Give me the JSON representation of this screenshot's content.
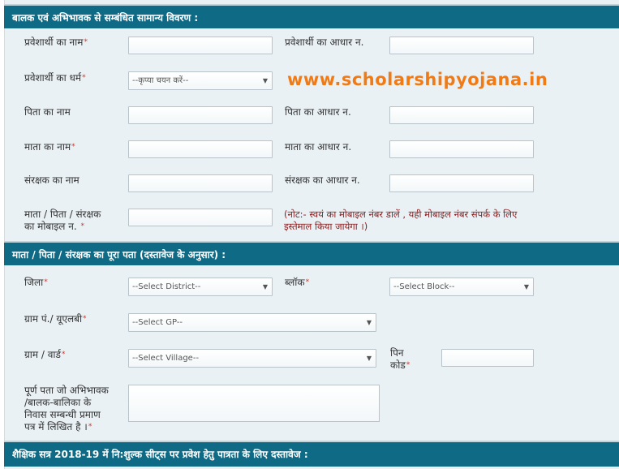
{
  "sections": {
    "general": {
      "title": "बालक एवं अभिभावक से सम्बंधित सामान्य विवरण :"
    },
    "address": {
      "title": "माता / पिता / संरक्षक का पूरा पता (दस्तावेज के अनुसार) :"
    },
    "documents": {
      "title": "शैक्षिक सत्र 2018-19 में नि:शुल्क सीट्स पर प्रवेश हेतु पात्रता के लिए दस्तावेज :"
    }
  },
  "required_marker": "*",
  "fields": {
    "student_name": {
      "label": "प्रवेशार्थी का नाम",
      "value": ""
    },
    "student_aadhar": {
      "label": "प्रवेशार्थी का आधार न.",
      "value": ""
    },
    "student_religion": {
      "label": "प्रवेशार्थी का धर्म",
      "selected": "--कृप्या चयन करें--"
    },
    "father_name": {
      "label": "पिता का नाम",
      "value": ""
    },
    "father_aadhar": {
      "label": "पिता का आधार न.",
      "value": ""
    },
    "mother_name": {
      "label": "माता का नाम",
      "value": ""
    },
    "mother_aadhar": {
      "label": "माता का आधार न.",
      "value": ""
    },
    "guardian_name": {
      "label": "संरक्षक का नाम",
      "value": ""
    },
    "guardian_aadhar": {
      "label": "संरक्षक का आधार न.",
      "value": ""
    },
    "mobile": {
      "label_line1": "माता / पिता / संरक्षक",
      "label_line2": "का मोबाइल न.",
      "value": ""
    },
    "mobile_note": {
      "line1": "(नोट:- स्वयं का मोबाइल नंबर डालें , यही मोबाइल नंबर संपर्क के लिए",
      "line2": "इस्तेमाल किया जायेगा ।)"
    },
    "district": {
      "label": "जिला",
      "selected": "--Select District--"
    },
    "block": {
      "label": "ब्लॉक",
      "selected": "--Select Block--"
    },
    "gp": {
      "label": "ग्राम पं./ यूएलबी",
      "selected": "--Select GP--"
    },
    "village": {
      "label": "ग्राम / वार्ड",
      "selected": "--Select Village--"
    },
    "pincode": {
      "label_line1": "पिन",
      "label_line2": "कोड",
      "value": ""
    },
    "full_address": {
      "label_lines": [
        "पूर्ण पता जो अभिभावक",
        "/बालक-बालिका के",
        "निवास सम्बन्धी प्रमाण",
        "पत्र में लिखित है ।"
      ],
      "value": ""
    }
  },
  "watermark": "www.scholarshipyojana.in",
  "caret": "▼"
}
